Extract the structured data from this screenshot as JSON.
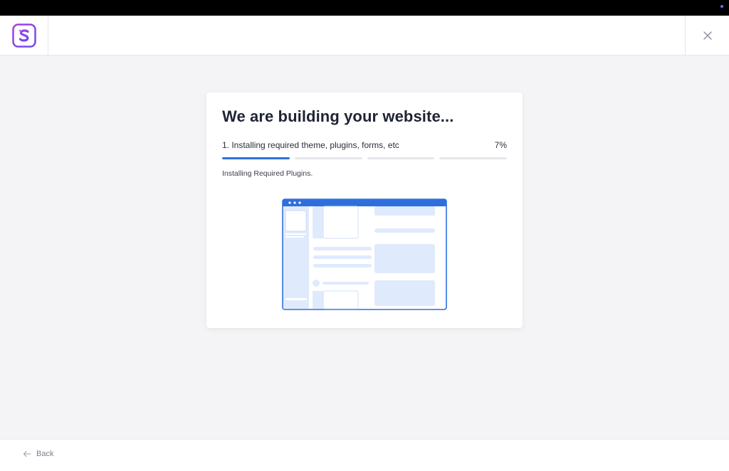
{
  "header": {
    "logo_icon": "s-brand-logo-icon",
    "close_icon": "close-icon"
  },
  "card": {
    "title": "We are building your website...",
    "step_label": "1. Installing required theme, plugins, forms, etc",
    "percent_text": "7%",
    "status_text": "Installing Required Plugins.",
    "progress": {
      "segments": 4,
      "active_segment_fill": 1.0
    },
    "illustration_icon": "website-wireframe-illustration"
  },
  "footer": {
    "back_label": "Back",
    "back_icon": "arrow-left-icon"
  },
  "colors": {
    "accent": "#2f6fdd",
    "brand": "#8a3ff0",
    "background": "#f4f4f6"
  }
}
